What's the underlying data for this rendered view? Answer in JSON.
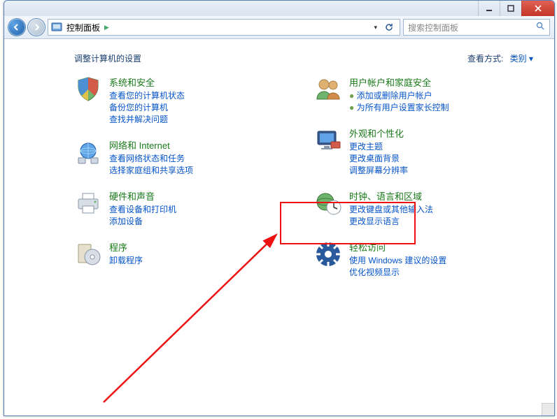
{
  "window": {
    "title": ""
  },
  "nav": {
    "address": "控制面板",
    "searchPlaceholder": "搜索控制面板"
  },
  "page": {
    "heading": "调整计算机的设置",
    "viewByLabel": "查看方式:",
    "viewByValue": "类别 ▾"
  },
  "left": [
    {
      "title": "系统和安全",
      "links": [
        "查看您的计算机状态",
        "备份您的计算机",
        "查找并解决问题"
      ]
    },
    {
      "title": "网络和 Internet",
      "links": [
        "查看网络状态和任务",
        "选择家庭组和共享选项"
      ]
    },
    {
      "title": "硬件和声音",
      "links": [
        "查看设备和打印机",
        "添加设备"
      ]
    },
    {
      "title": "程序",
      "links": [
        "卸载程序"
      ]
    }
  ],
  "right": [
    {
      "title": "用户帐户和家庭安全",
      "links": [
        "添加或删除用户帐户",
        "为所有用户设置家长控制"
      ],
      "bullets": true
    },
    {
      "title": "外观和个性化",
      "links": [
        "更改主题",
        "更改桌面背景",
        "调整屏幕分辨率"
      ]
    },
    {
      "title": "时钟、语言和区域",
      "links": [
        "更改键盘或其他输入法",
        "更改显示语言"
      ]
    },
    {
      "title": "轻松访问",
      "links": [
        "使用 Windows 建议的设置",
        "优化视频显示"
      ]
    }
  ]
}
